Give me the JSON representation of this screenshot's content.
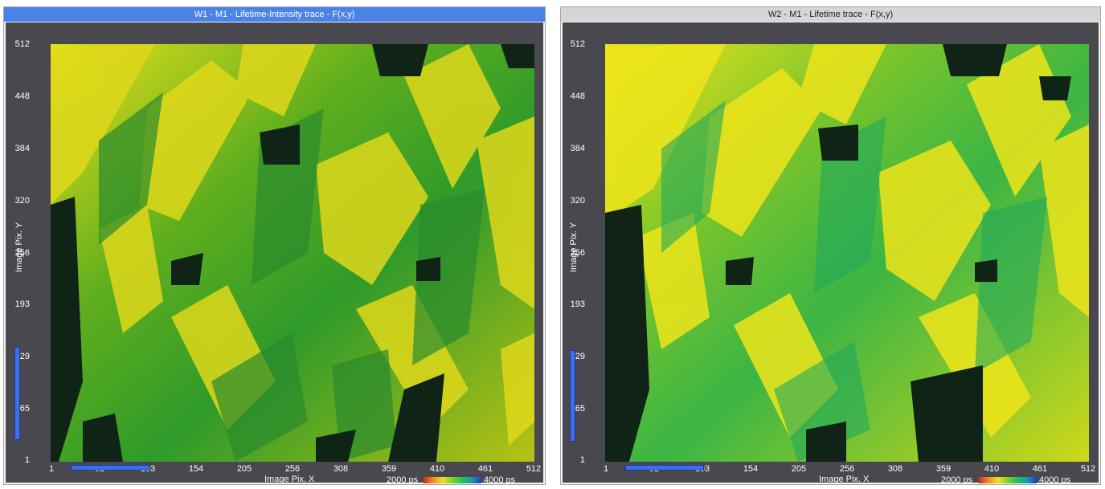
{
  "windows": [
    {
      "title": "W1 - M1 - Lifetime-Intensity trace  - F(x,y)",
      "title_bg": "#4a83e8",
      "y_label": "Image Pix. Y",
      "x_label": "Image Pix. X",
      "y_ticks": [
        "512",
        "448",
        "384",
        "320",
        "256",
        "193",
        "129",
        "65",
        "1"
      ],
      "x_ticks": [
        "1",
        "52",
        "103",
        "154",
        "205",
        "256",
        "308",
        "359",
        "410",
        "461",
        "512"
      ],
      "colorbar": {
        "min_label": "2000 ps",
        "max_label": "4000 ps"
      }
    },
    {
      "title": "W2 - M1 - Lifetime trace  - F(x,y)",
      "title_bg": "#d6d6d6",
      "y_label": "Image Pix. Y",
      "x_label": "Image Pix. X",
      "y_ticks": [
        "512",
        "448",
        "384",
        "320",
        "256",
        "193",
        "129",
        "65",
        "1"
      ],
      "x_ticks": [
        "1",
        "52",
        "103",
        "154",
        "205",
        "256",
        "308",
        "359",
        "410",
        "461",
        "512"
      ],
      "colorbar": {
        "min_label": "2000 ps",
        "max_label": "4000 ps"
      }
    }
  ],
  "colors": {
    "panel_bg": "#48484e",
    "colormap": [
      "#d42a1a",
      "#f08d1c",
      "#f2e01a",
      "#7bd12a",
      "#1fc065",
      "#1d9aa5",
      "#1a3cd6"
    ],
    "scroll_handle": "#3f6fe6"
  }
}
